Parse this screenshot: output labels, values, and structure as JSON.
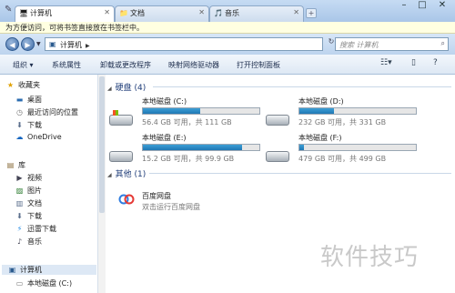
{
  "tabs": [
    {
      "label": "计算机",
      "active": true
    },
    {
      "label": "文档",
      "active": false
    },
    {
      "label": "音乐",
      "active": false
    }
  ],
  "infobar": {
    "text": "为方便访问，可将书签直接放在书签栏中。"
  },
  "address": {
    "path": "计算机",
    "search_placeholder": "搜索 计算机"
  },
  "toolbar": {
    "organize": "组织 ▾",
    "system_properties": "系统属性",
    "uninstall": "卸载或更改程序",
    "map_drive": "映射网络驱动器",
    "control_panel": "打开控制面板"
  },
  "sidebar": {
    "favorites": "收藏夹",
    "desktop": "桌面",
    "recent": "最近访问的位置",
    "downloads": "下载",
    "onedrive": "OneDrive",
    "libraries": "库",
    "videos": "视频",
    "pictures": "图片",
    "documents": "文档",
    "lib_downloads": "下载",
    "thunder": "迅雷下载",
    "music": "音乐",
    "computer": "计算机",
    "local_c": "本地磁盘 (C:)"
  },
  "content": {
    "hard_disks": "硬盘 (4)",
    "drives": [
      {
        "name": "本地磁盘 (C:)",
        "free": "56.4 GB 可用，共 111 GB",
        "used_fraction": 0.49,
        "system": true
      },
      {
        "name": "本地磁盘 (D:)",
        "free": "232 GB 可用，共 331 GB",
        "used_fraction": 0.3,
        "system": false
      },
      {
        "name": "本地磁盘 (E:)",
        "free": "15.2 GB 可用，共 99.9 GB",
        "used_fraction": 0.85,
        "system": false
      },
      {
        "name": "本地磁盘 (F:)",
        "free": "479 GB 可用，共 499 GB",
        "used_fraction": 0.04,
        "system": false
      }
    ],
    "others": "其他 (1)",
    "other_name": "百度网盘",
    "other_desc": "双击运行百度网盘"
  },
  "watermark": "软件技巧",
  "colors": {
    "accent": "#1f77b4",
    "link": "#1e3c78"
  }
}
